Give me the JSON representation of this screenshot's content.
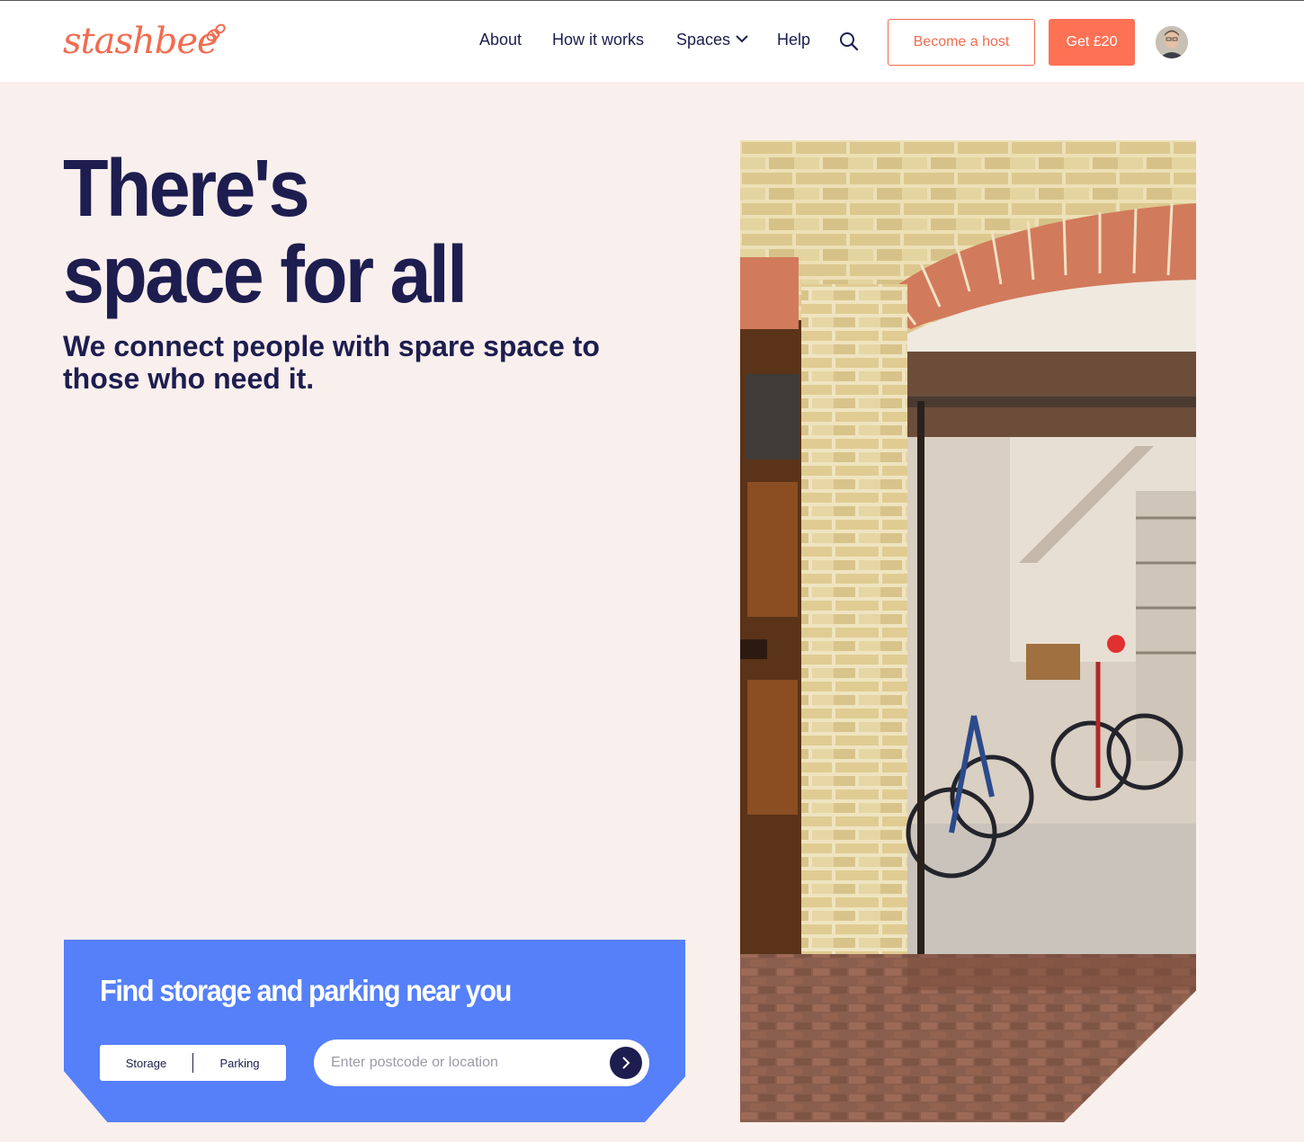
{
  "header": {
    "logo_text": "stashbee",
    "nav": {
      "about": "About",
      "how_it_works": "How it works",
      "spaces": "Spaces",
      "help": "Help"
    },
    "become_host": "Become a host",
    "get_reward": "Get £20"
  },
  "hero": {
    "title_line1": "There's",
    "title_line2": "space for all",
    "subtitle": "We connect people with spare space to those who need it."
  },
  "search": {
    "title": "Find storage and parking near you",
    "toggle": [
      "Storage",
      "Parking"
    ],
    "placeholder": "Enter postcode or location"
  },
  "colors": {
    "brand_orange": "#fd7155",
    "navy": "#1d1d4f",
    "blue": "#5580f9",
    "background": "#f9efed"
  },
  "icons": [
    "bee-icon",
    "chevron-down-icon",
    "search-icon",
    "arrow-right-icon"
  ]
}
